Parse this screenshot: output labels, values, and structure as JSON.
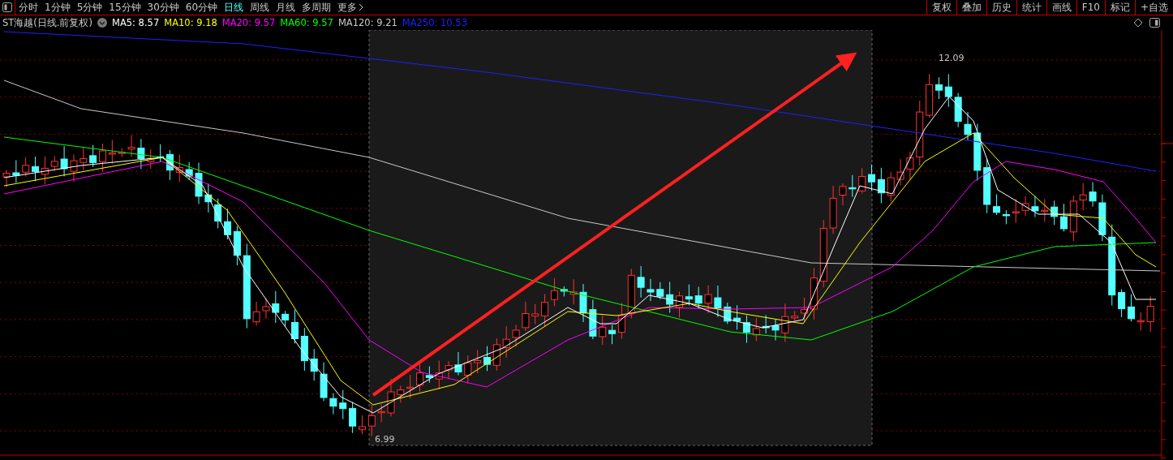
{
  "toolbar": {
    "period_tabs": [
      {
        "label": "分时",
        "selected": false
      },
      {
        "label": "1分钟",
        "selected": false
      },
      {
        "label": "5分钟",
        "selected": false
      },
      {
        "label": "15分钟",
        "selected": false
      },
      {
        "label": "30分钟",
        "selected": false
      },
      {
        "label": "60分钟",
        "selected": false
      },
      {
        "label": "日线",
        "selected": true
      },
      {
        "label": "周线",
        "selected": false
      },
      {
        "label": "月线",
        "selected": false
      },
      {
        "label": "多周期",
        "selected": false
      }
    ],
    "more": "更多",
    "right_buttons": [
      "复权",
      "叠加",
      "历史",
      "统计",
      "画线",
      "F10",
      "标记",
      "+自选"
    ]
  },
  "legend": {
    "title": "ST海越(日线.前复权)",
    "indicators": [
      {
        "label": "MA5: 8.57",
        "color": "#ffffff"
      },
      {
        "label": "MA10: 9.18",
        "color": "#ffff00"
      },
      {
        "label": "MA20: 9.57",
        "color": "#ff00ff"
      },
      {
        "label": "MA60: 9.57",
        "color": "#00ff00"
      },
      {
        "label": "MA120: 9.21",
        "color": "#c8c8c8"
      },
      {
        "label": "MA250: 10.53",
        "color": "#2020ff"
      }
    ]
  },
  "chart": {
    "high_label": "12.09",
    "low_label": "6.99"
  }
}
